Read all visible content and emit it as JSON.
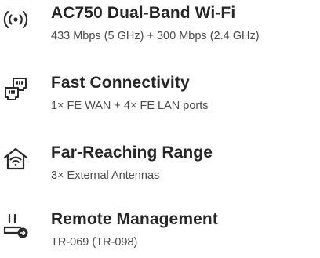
{
  "features": [
    {
      "icon": "wifi-signal-icon",
      "title": "AC750 Dual-Band Wi-Fi",
      "subtitle": "433 Mbps (5 GHz) + 300 Mbps (2.4 GHz)"
    },
    {
      "icon": "network-ports-icon",
      "title": "Fast Connectivity",
      "subtitle": "1× FE WAN + 4× FE LAN ports"
    },
    {
      "icon": "home-wifi-icon",
      "title": "Far-Reaching Range",
      "subtitle": "3× External Antennas"
    },
    {
      "icon": "remote-management-icon",
      "title": "Remote Management",
      "subtitle": "TR-069 (TR-098)"
    }
  ],
  "colors": {
    "text_primary": "#262626",
    "text_secondary": "#4a4a4a",
    "icon": "#2b2b2b",
    "background": "#ffffff"
  }
}
